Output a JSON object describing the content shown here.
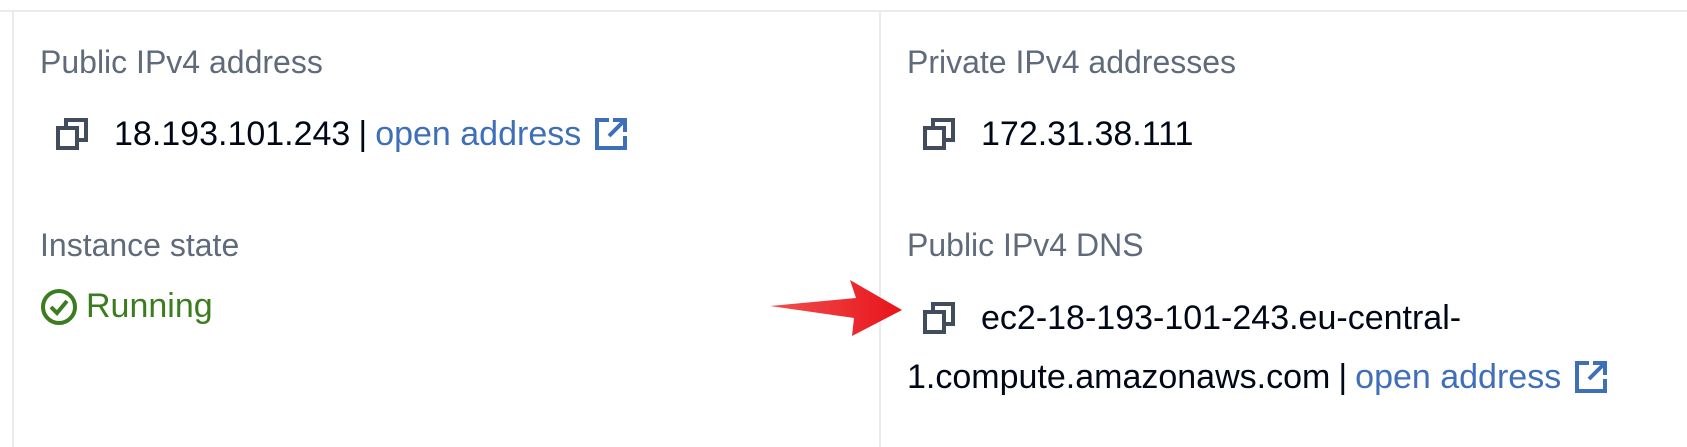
{
  "details": {
    "public_ipv4": {
      "label": "Public IPv4 address",
      "value": "18.193.101.243",
      "separator": "|",
      "link_text": "open address"
    },
    "private_ipv4": {
      "label": "Private IPv4 addresses",
      "value": "172.31.38.111"
    },
    "instance_state": {
      "label": "Instance state",
      "value": "Running",
      "status_color": "#3b7d1e"
    },
    "public_dns": {
      "label": "Public IPv4 DNS",
      "value_line1": "ec2-18-193-101-243.eu-central-",
      "value_line2": "1.compute.amazonaws.com",
      "separator": "|",
      "link_text": "open address"
    }
  },
  "icons": {
    "copy": "copy-icon",
    "external": "external-link-icon",
    "status_ok": "check-circle-icon",
    "annotation": "red-arrow-icon"
  },
  "colors": {
    "link": "#3f6fb8",
    "label": "#5f6b7a",
    "value": "#000716",
    "arrow": "#e8141a"
  }
}
